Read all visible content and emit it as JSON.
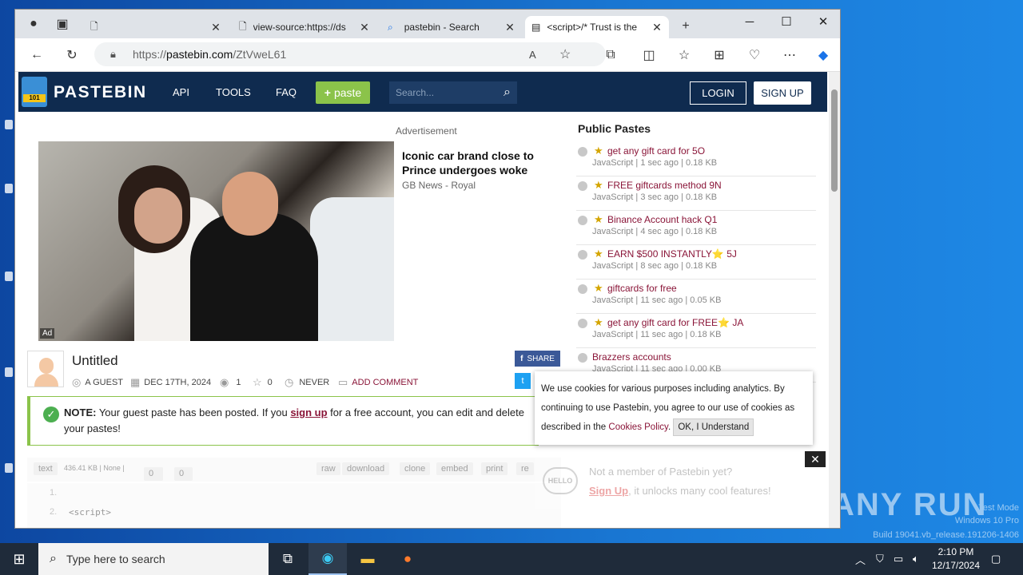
{
  "browser": {
    "tabs": [
      {
        "title": "",
        "icon": "page-icon"
      },
      {
        "title": "view-source:https://ds",
        "icon": "page-icon"
      },
      {
        "title": "pastebin - Search",
        "icon": "search-icon"
      },
      {
        "title": "<script>/* Trust is the",
        "icon": "pastebin-icon"
      }
    ],
    "url_scheme": "https://",
    "url_host": "pastebin.com",
    "url_path": "/ZtVweL61"
  },
  "pastebin": {
    "brand": "PASTEBIN",
    "nav": [
      "API",
      "TOOLS",
      "FAQ"
    ],
    "paste_button": "paste",
    "search_placeholder": "Search...",
    "login": "LOGIN",
    "signup": "SIGN UP",
    "ad_label": "Advertisement",
    "ad_title": "Iconic car brand close to Prince undergoes woke makeover",
    "ad_source": "GB News - Royal",
    "ad_badge": "Ad",
    "paste_title": "Untitled",
    "author": "A GUEST",
    "date": "DEC 17TH, 2024",
    "views": "1",
    "stars": "0",
    "expiry": "NEVER",
    "add_comment": "ADD COMMENT",
    "share_fb": "SHARE",
    "notice_bold": "NOTE:",
    "notice_pre": " Your guest paste has been posted. If you ",
    "notice_link": "sign up",
    "notice_post": " for a free account, you can edit and delete your pastes!",
    "code_toolbar": {
      "format": "text",
      "size": "436.41 KB | None |",
      "likes": "0",
      "dislikes": "0",
      "actions": [
        "raw",
        "download",
        "clone",
        "embed",
        "print",
        "re"
      ]
    },
    "code_lines": [
      {
        "n": "1.",
        "code": ""
      },
      {
        "n": "2.",
        "code": "<script>"
      }
    ]
  },
  "public_pastes": {
    "heading": "Public Pastes",
    "items": [
      {
        "title": "get any gift card for 5O",
        "meta": "JavaScript | 1 sec ago | 0.18 KB"
      },
      {
        "title": "FREE giftcards method 9N",
        "meta": "JavaScript | 3 sec ago | 0.18 KB"
      },
      {
        "title": "Binance Account hack Q1",
        "meta": "JavaScript | 4 sec ago | 0.18 KB"
      },
      {
        "title": "EARN $500 INSTANTLY⭐ 5J",
        "meta": "JavaScript | 8 sec ago | 0.18 KB"
      },
      {
        "title": "giftcards for free",
        "meta": "JavaScript | 11 sec ago | 0.05 KB"
      },
      {
        "title": "get any gift card for FREE⭐ JA",
        "meta": "JavaScript | 11 sec ago | 0.18 KB"
      },
      {
        "title": "Brazzers accounts",
        "meta": "JavaScript | 11 sec ago | 0.00 KB"
      }
    ]
  },
  "cookie": {
    "text": "We use cookies for various purposes including analytics. By continuing to use Pastebin, you agree to our use of cookies as described in the ",
    "link": "Cookies Policy",
    "ok": "OK, I Understand"
  },
  "member": {
    "hello": "HELLO",
    "line1": "Not a member of Pastebin yet?",
    "link": "Sign Up",
    "line2": ", it unlocks many cool features!"
  },
  "watermark": {
    "logo": "ANY RUN",
    "line1": "Test Mode",
    "line2": "Windows 10 Pro",
    "line3": "Build 19041.vb_release.191206-1406"
  },
  "taskbar": {
    "search_placeholder": "Type here to search",
    "time": "2:10 PM",
    "date": "12/17/2024"
  },
  "colors": {
    "brand": "#0f2b4f",
    "accent": "#8a1538",
    "green": "#8bc34a"
  }
}
